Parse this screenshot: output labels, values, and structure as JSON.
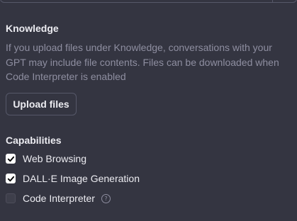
{
  "knowledge": {
    "title": "Knowledge",
    "description": "If you upload files under Knowledge, conversations with your GPT may include file contents. Files can be downloaded when Code Interpreter is enabled",
    "upload_label": "Upload files"
  },
  "capabilities": {
    "title": "Capabilities",
    "items": [
      {
        "label": "Web Browsing",
        "checked": true
      },
      {
        "label": "DALL·E Image Generation",
        "checked": true
      },
      {
        "label": "Code Interpreter",
        "checked": false,
        "help_icon": "question-mark-icon"
      }
    ]
  },
  "colors": {
    "background": "#343541",
    "text": "#ececf1",
    "muted_text": "#8e8ea0",
    "border": "#565869"
  }
}
